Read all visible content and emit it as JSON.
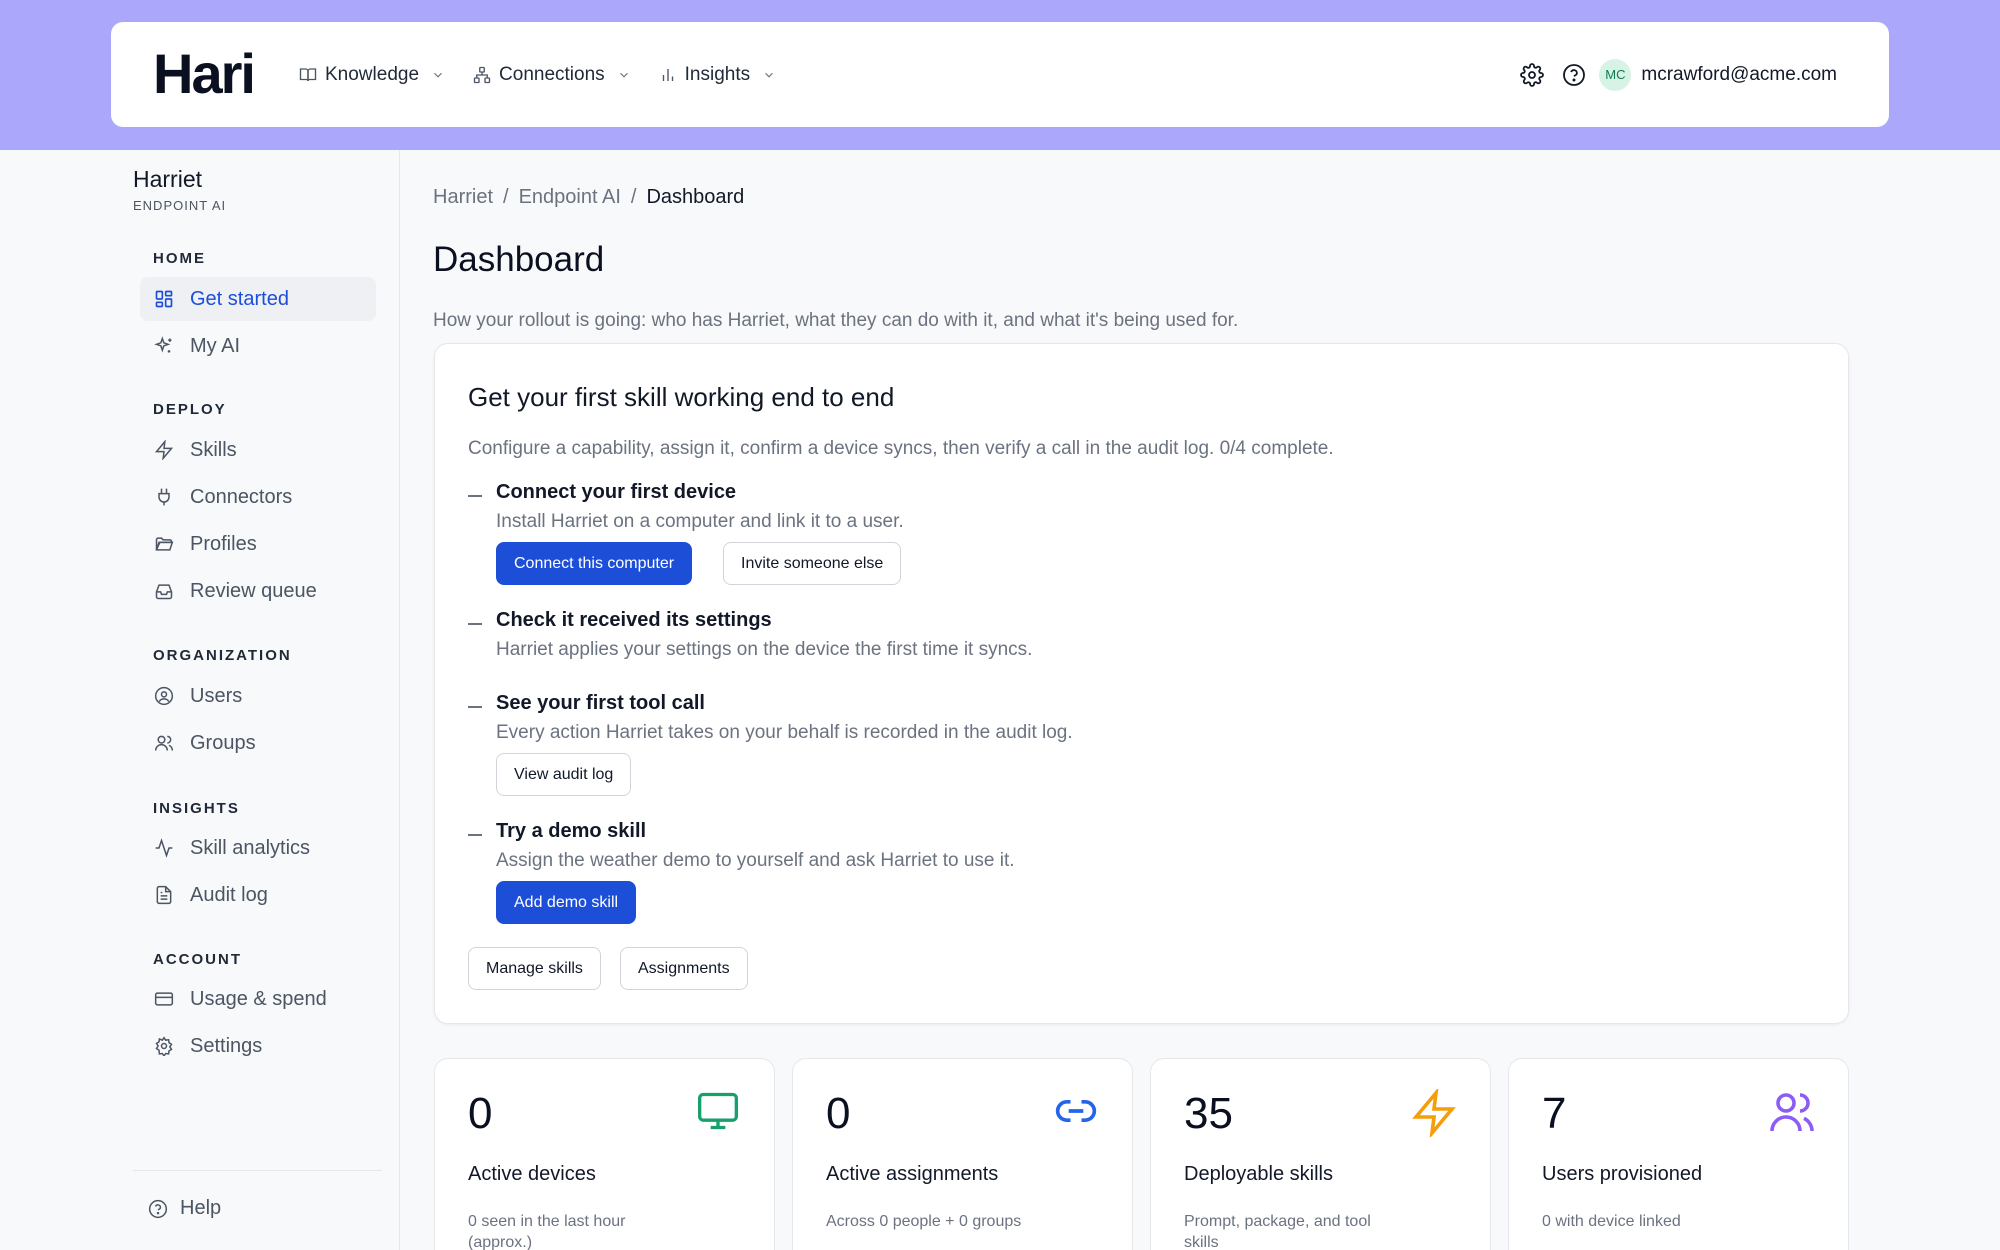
{
  "app": {
    "logo": "Hari"
  },
  "nav": {
    "knowledge": "Knowledge",
    "connections": "Connections",
    "insights": "Insights"
  },
  "user": {
    "initials": "MC",
    "email": "mcrawford@acme.com"
  },
  "sidebar": {
    "org_name": "Harriet",
    "org_sub": "ENDPOINT AI",
    "sections": {
      "home": "HOME",
      "deploy": "DEPLOY",
      "organization": "ORGANIZATION",
      "insights": "INSIGHTS",
      "account": "ACCOUNT"
    },
    "items": {
      "get_started": "Get started",
      "my_ai": "My AI",
      "skills": "Skills",
      "connectors": "Connectors",
      "profiles": "Profiles",
      "review_queue": "Review queue",
      "users": "Users",
      "groups": "Groups",
      "skill_analytics": "Skill analytics",
      "audit_log": "Audit log",
      "usage_spend": "Usage & spend",
      "settings": "Settings"
    },
    "help": "Help"
  },
  "breadcrumb": {
    "items": [
      "Harriet",
      "Endpoint AI",
      "Dashboard"
    ],
    "separator": "/"
  },
  "page": {
    "title": "Dashboard",
    "description": "How your rollout is going: who has Harriet, what they can do with it, and what it's being used for."
  },
  "onboarding": {
    "title": "Get your first skill working end to end",
    "description": "Configure a capability, assign it, confirm a device syncs, then verify a call in the audit log. 0/4 complete.",
    "steps": [
      {
        "title": "Connect your first device",
        "desc": "Install Harriet on a computer and link it to a user.",
        "primary": "Connect this computer",
        "secondary": "Invite someone else"
      },
      {
        "title": "Check it received its settings",
        "desc": "Harriet applies your settings on the device the first time it syncs."
      },
      {
        "title": "See your first tool call",
        "desc": "Every action Harriet takes on your behalf is recorded in the audit log.",
        "secondary": "View audit log"
      },
      {
        "title": "Try a demo skill",
        "desc": "Assign the weather demo to yourself and ask Harriet to use it.",
        "primary": "Add demo skill"
      }
    ],
    "footer_buttons": [
      "Manage skills",
      "Assignments"
    ]
  },
  "stats": [
    {
      "value": "0",
      "label": "Active devices",
      "sub": "0 seen in the last hour (approx.)",
      "icon": "monitor-icon",
      "color": "#16a06b"
    },
    {
      "value": "0",
      "label": "Active assignments",
      "sub": "Across 0 people + 0 groups",
      "icon": "link-icon",
      "color": "#2563eb"
    },
    {
      "value": "35",
      "label": "Deployable skills",
      "sub": "Prompt, package, and tool skills",
      "icon": "lightning-icon",
      "color": "#f59e0b"
    },
    {
      "value": "7",
      "label": "Users provisioned",
      "sub": "0 with device linked",
      "icon": "users-icon",
      "color": "#8b5cf6"
    }
  ],
  "colors": {
    "banner": "#aba7fb",
    "primary": "#1d4ed8",
    "active_nav": "#1d4ed8"
  }
}
